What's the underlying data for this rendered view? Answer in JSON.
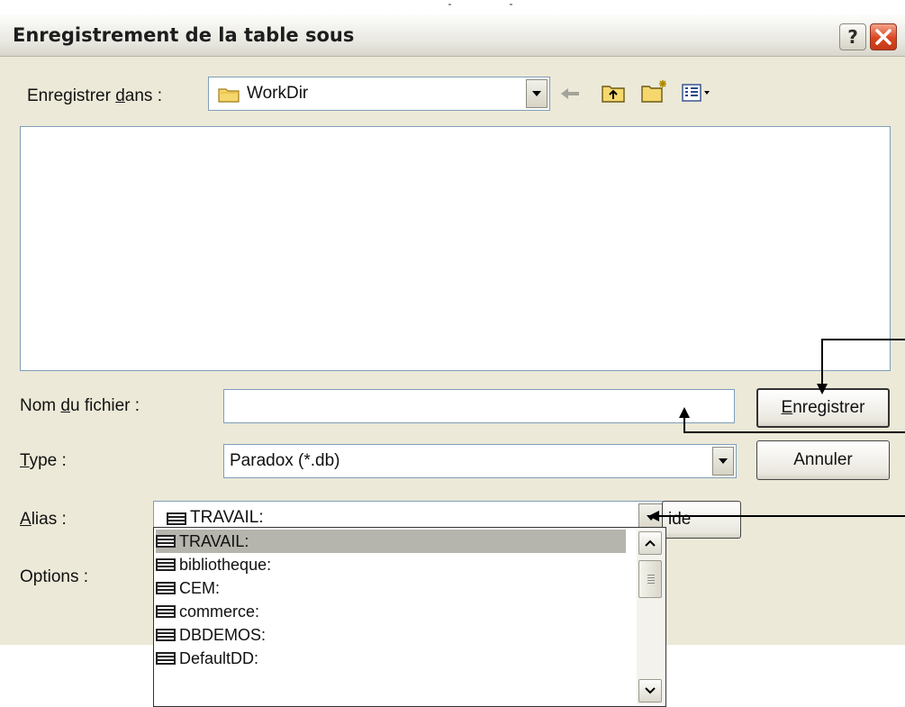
{
  "window": {
    "title": "Enregistrement de la table sous"
  },
  "save_in": {
    "label_pre": "Enregistrer ",
    "label_u": "d",
    "label_post": "ans :",
    "value": "WorkDir"
  },
  "filename": {
    "label_pre": "Nom ",
    "label_u": "d",
    "label_post": "u fichier :",
    "value": ""
  },
  "type": {
    "label_u": "T",
    "label_post": "ype :",
    "value": "Paradox (*.db)"
  },
  "alias": {
    "label_u": "A",
    "label_post": "lias :",
    "value": "TRAVAIL:"
  },
  "options": {
    "label": "Options :"
  },
  "buttons": {
    "save_u": "E",
    "save_rest": "nregistrer",
    "cancel": "Annuler",
    "help_partial": "ide"
  },
  "alias_options": [
    "TRAVAIL:",
    "bibliotheque:",
    "CEM:",
    "commerce:",
    "DBDEMOS:",
    "DefaultDD:"
  ],
  "icons": [
    "help-icon",
    "close-icon",
    "folder-icon",
    "back-arrow-icon",
    "up-folder-icon",
    "new-folder-icon",
    "view-menu-icon",
    "database-icon"
  ]
}
